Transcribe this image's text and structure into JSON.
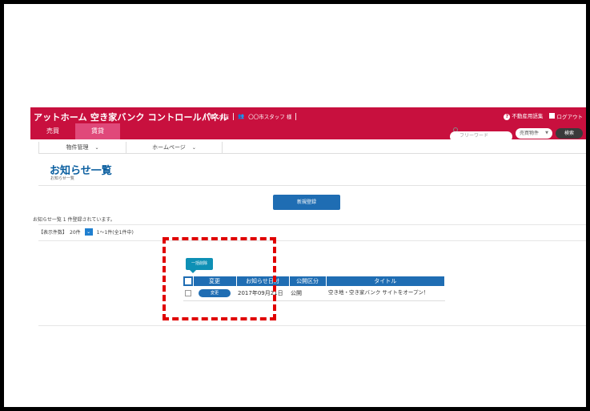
{
  "app": {
    "title": "アットホーム 空き家バンク コントロールパネル",
    "nav_office": "本店",
    "nav_user": "〇〇市スタッフ 様",
    "mode_tabs": [
      {
        "label": "売買",
        "active": false
      },
      {
        "label": "賃貸",
        "active": true
      }
    ],
    "help_label": "不動産用語集",
    "logout_label": "ログアウト"
  },
  "search": {
    "placeholder": "フリーワード",
    "type_selected": "売買物件",
    "button_label": "検索"
  },
  "subnav": {
    "items": [
      {
        "label": "物件管理"
      },
      {
        "label": "ホームページ"
      }
    ]
  },
  "page": {
    "title": "お知らせ一覧",
    "breadcrumb": "お知らせ一覧",
    "new_button": "新規登録",
    "count_text": "お知らせ一覧 1 件登録されています。",
    "perpage_label": "【表示件数】",
    "perpage_value": "20件",
    "range_text": "1～1件(全1件中)",
    "bulk_delete": "一括削除"
  },
  "table": {
    "headers": [
      "変更",
      "お知らせ日付",
      "公開区分",
      "タイトル"
    ],
    "rows": [
      {
        "edit_label": "変更",
        "date": "2017年09月21日",
        "status": "公開",
        "title": "空き地・空き家バンク サイトをオープン！"
      }
    ]
  },
  "colors": {
    "brand": "#c8103e",
    "primary": "#1f6db3",
    "highlight": "#e00000"
  }
}
